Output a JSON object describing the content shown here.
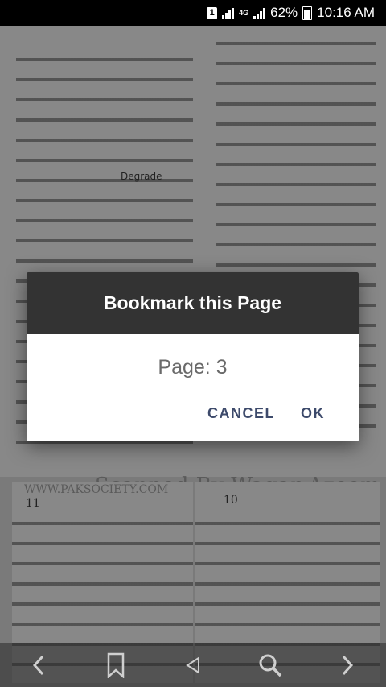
{
  "status_bar": {
    "sim_slot": "1",
    "network_type": "4G",
    "battery": "62%",
    "time": "10:16 AM"
  },
  "background_page": {
    "watermark": "Scanned By Waqar Azeem",
    "site": "WWW.PAKSOCIETY.COM",
    "left_page_number": "11",
    "right_page_number": "10",
    "inline_english_word": "Degrade"
  },
  "dialog": {
    "title": "Bookmark this Page",
    "message": "Page: 3",
    "cancel_label": "CANCEL",
    "ok_label": "OK"
  },
  "toolbar": {
    "icons": [
      "back-icon",
      "bookmark-icon",
      "triangle-nav-icon",
      "search-icon",
      "forward-icon"
    ]
  }
}
